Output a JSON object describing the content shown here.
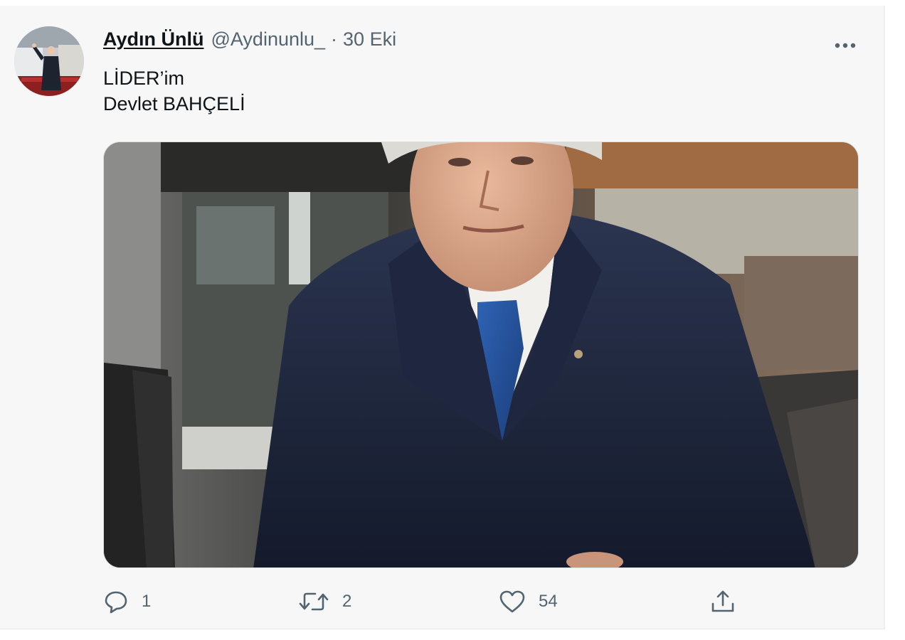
{
  "tweet": {
    "author": {
      "display_name": "Aydın Ünlü",
      "handle": "@Aydinunlu_"
    },
    "separator": "·",
    "timestamp": "30 Eki",
    "text_lines": [
      "LİDER’im",
      "Devlet BAHÇELİ"
    ],
    "actions": {
      "reply_count": "1",
      "retweet_count": "2",
      "like_count": "54"
    }
  },
  "colors": {
    "text_primary": "#0f1419",
    "text_secondary": "#536471",
    "card_background": "#f7f7f7"
  },
  "icons": {
    "more": "more-horizontal-icon",
    "reply": "reply-bubble-icon",
    "retweet": "retweet-arrows-icon",
    "like": "heart-outline-icon",
    "share": "share-upload-icon"
  }
}
